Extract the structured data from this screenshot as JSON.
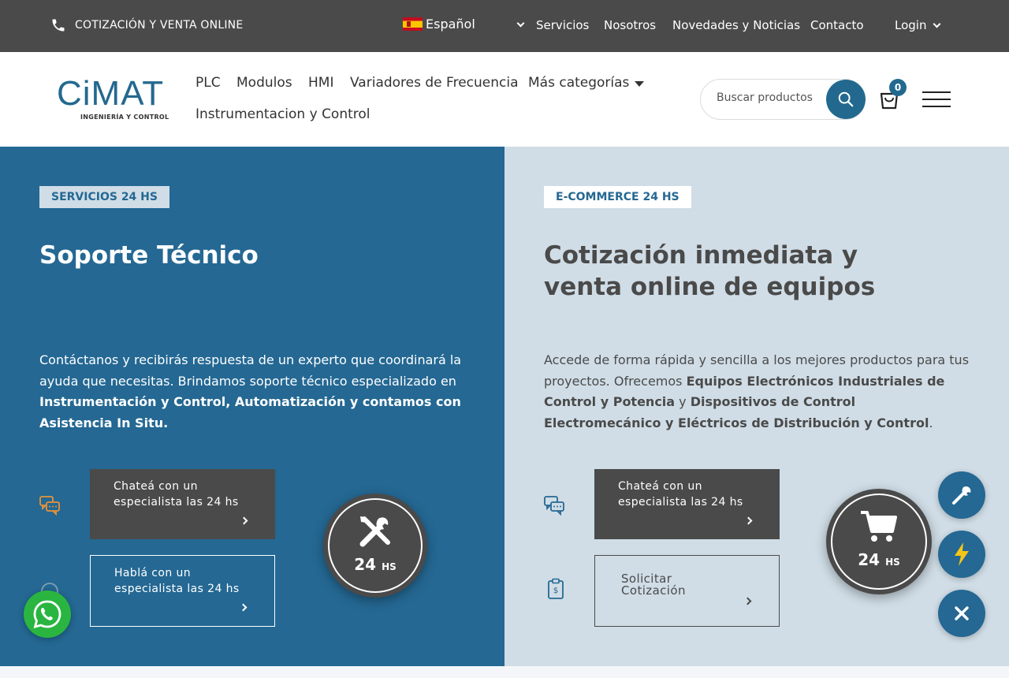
{
  "topbar": {
    "cta": "COTIZACIÓN Y VENTA ONLINE",
    "language": "Español",
    "nav": [
      "Servicios",
      "Nosotros",
      "Novedades y Noticias",
      "Contacto"
    ],
    "login": "Login"
  },
  "header": {
    "logo_main": "CiMAT",
    "logo_sub": "INGENIERÍA Y CONTROL",
    "nav": [
      "PLC",
      "Modulos",
      "HMI",
      "Variadores de Frecuencia",
      "Más categorías",
      "Instrumentacion y Control"
    ],
    "search_placeholder": "Buscar productos",
    "cart_count": "0"
  },
  "left_panel": {
    "tag": "SERVICIOS 24 HS",
    "title": "Soporte Técnico",
    "desc_plain": "Contáctanos y recibirás respuesta de un experto que coordinará la ayuda que necesitas. Brindamos soporte técnico especializado en ",
    "desc_bold": "Instrumentación y Control, Automatización y contamos con Asistencia In Situ.",
    "btn_chat": "Chateá con un especialista las 24 hs",
    "btn_call": "Hablá con un especialista las 24 hs",
    "clock_num": "24",
    "clock_unit": "HS"
  },
  "right_panel": {
    "tag": "E-COMMERCE 24 HS",
    "title_line1": "Cotización inmediata y",
    "title_line2": "venta online de equipos",
    "desc_1": "Accede de forma rápida y sencilla a los mejores productos para tus proyectos. Ofrecemos ",
    "desc_bold1": "Equipos Electrónicos Industriales de Control y Potencia",
    "desc_2": " y ",
    "desc_bold2": "Dispositivos de Control Electromecánico y Eléctricos de Distribución y Control",
    "desc_3": ".",
    "btn_chat": "Chateá con un especialista las 24 hs",
    "btn_quote_1": "Solicitar",
    "btn_quote_2": "Cotización",
    "clock_num": "24",
    "clock_unit": "HS"
  },
  "colors": {
    "brand_blue": "#246893",
    "light_blue": "#d0dde6",
    "dark_gray": "#4a4a4a",
    "whatsapp_green": "#2ab540",
    "accent_orange": "#e8923a"
  }
}
